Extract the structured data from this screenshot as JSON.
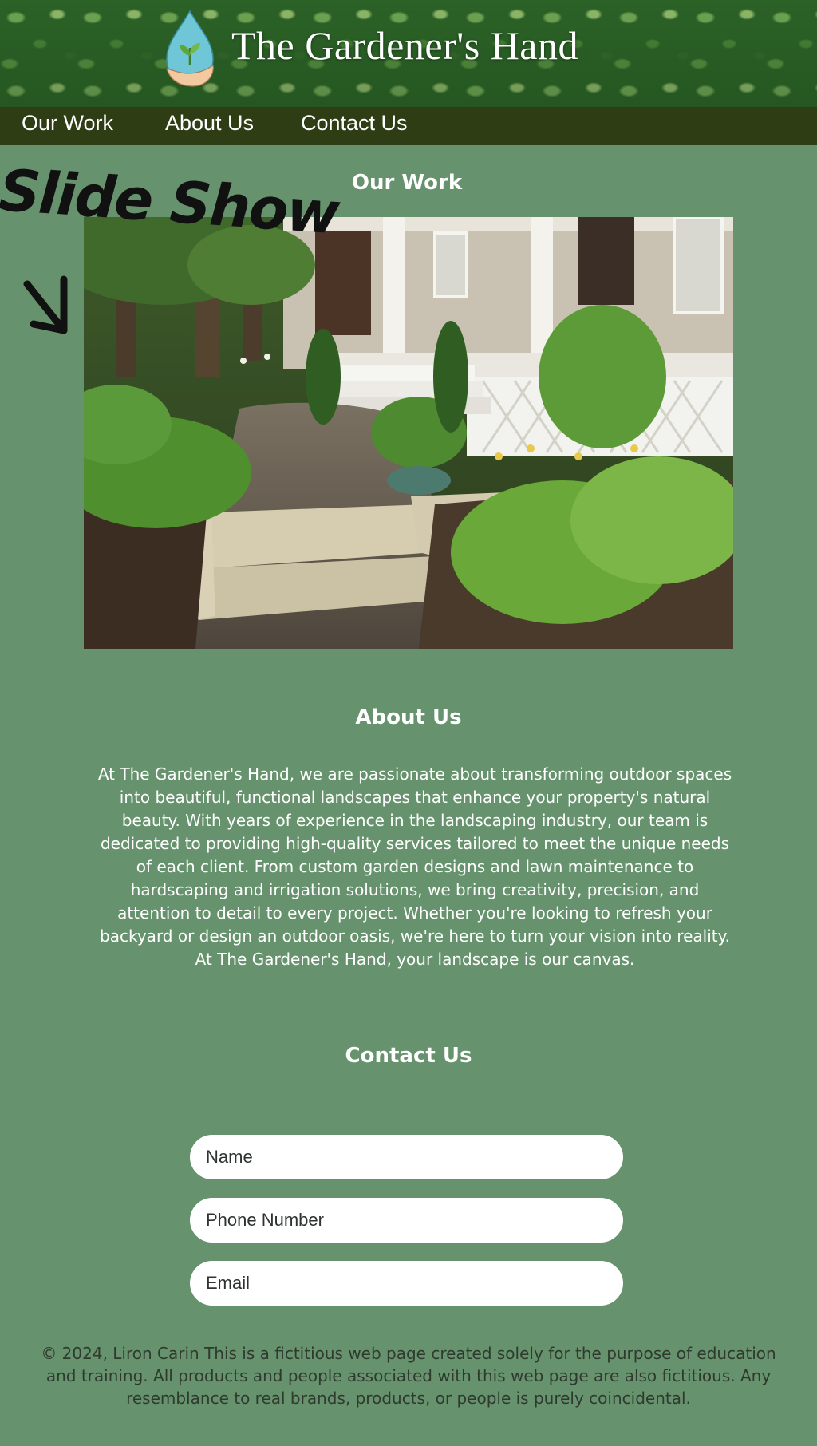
{
  "header": {
    "site_title": "The Gardener's Hand",
    "logo_icon": "water-drop-hand-sprout-icon"
  },
  "nav": {
    "items": [
      {
        "label": "Our Work"
      },
      {
        "label": "About Us"
      },
      {
        "label": "Contact Us"
      }
    ]
  },
  "our_work": {
    "title": "Our Work",
    "annotation": "Slide Show"
  },
  "about": {
    "title": "About Us",
    "body": "At The Gardener's Hand, we are passionate about transforming outdoor spaces into beautiful, functional landscapes that enhance your property's natural beauty. With years of experience in the landscaping industry, our team is dedicated to providing high-quality services tailored to meet the unique needs of each client. From custom garden designs and lawn maintenance to hardscaping and irrigation solutions, we bring creativity, precision, and attention to detail to every project. Whether you're looking to refresh your backyard or design an outdoor oasis, we're here to turn your vision into reality. At The Gardener's Hand, your landscape is our canvas."
  },
  "contact": {
    "title": "Contact Us",
    "fields": [
      {
        "placeholder": "Name"
      },
      {
        "placeholder": "Phone Number"
      },
      {
        "placeholder": "Email"
      }
    ]
  },
  "footer": {
    "text": "© 2024, Liron Carin This is a fictitious web page created solely for the purpose of education and training. All products and people associated with this web page are also fictitious. Any resemblance to real brands, products, or people is purely coincidental."
  },
  "colors": {
    "page_bg": "#66936d",
    "nav_bg": "#2f3d15",
    "text": "#ffffff"
  }
}
